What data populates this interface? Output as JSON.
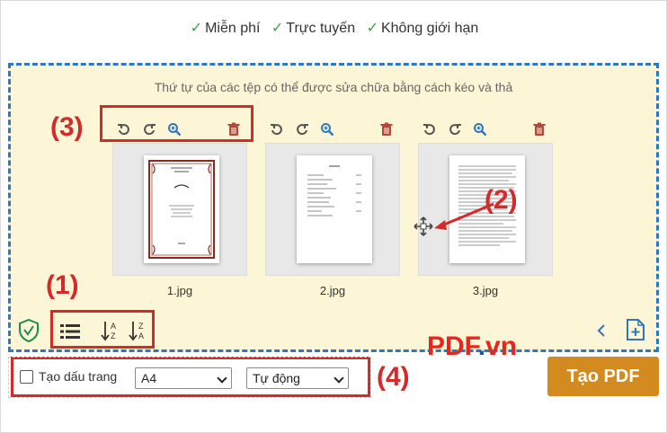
{
  "features": [
    "Miễn phí",
    "Trực tuyến",
    "Không giới hạn"
  ],
  "dropzone": {
    "hint": "Thứ tự của các tệp có thể được sửa chữa bằng cách kéo và thả"
  },
  "files": [
    {
      "name": "1.jpg",
      "thumb": "cover-page"
    },
    {
      "name": "2.jpg",
      "thumb": "list-page"
    },
    {
      "name": "3.jpg",
      "thumb": "text-page"
    }
  ],
  "file_tool_icons": [
    "rotate-left-icon",
    "rotate-right-icon",
    "zoom-icon",
    "trash-icon"
  ],
  "bottom_tools": [
    "list-view-icon",
    "sort-a-z-icon",
    "sort-z-a-icon"
  ],
  "annotations": {
    "one": "(1)",
    "two": "(2)",
    "three": "(3)",
    "four": "(4)"
  },
  "options": {
    "bookmark_label": "Tạo dấu trang",
    "bookmark_checked": false,
    "page_size": "A4",
    "orientation": "Tự động"
  },
  "create_button": "Tạo PDF",
  "brand": {
    "name": "PDF",
    "dot": ".",
    "tld": "vn"
  },
  "colors": {
    "dropzone_bg": "#fcf5d6",
    "dropzone_border": "#2e78c0",
    "annotation_red": "#d32a2a",
    "create_button_bg": "#d38a1f",
    "icon_blue": "#2e78c0",
    "trash_red": "#b14a3a",
    "check_green": "#3aa34a"
  }
}
